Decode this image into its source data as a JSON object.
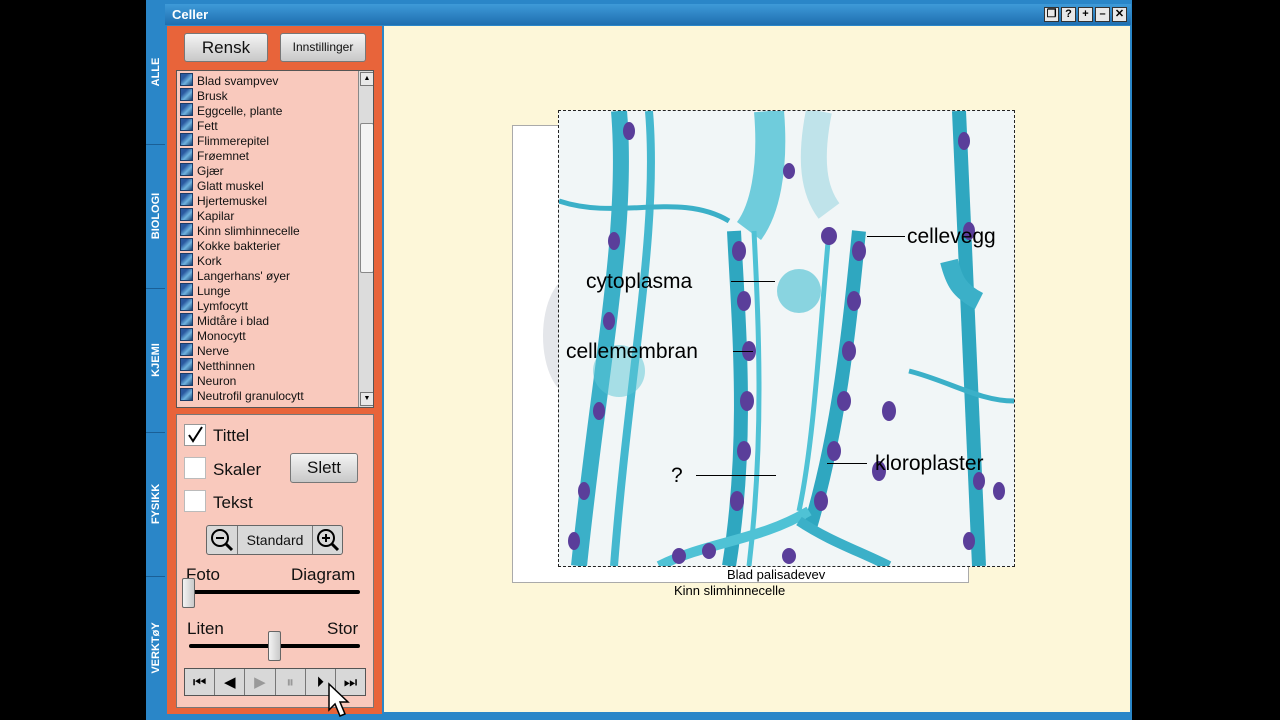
{
  "window": {
    "title": "Celler",
    "buttons": [
      "❐",
      "?",
      "+",
      "–",
      "✕"
    ]
  },
  "side_tabs": [
    "ALLE",
    "BIOLOGI",
    "KJEMI",
    "FYSIKK",
    "VERKTøY"
  ],
  "toolbar": {
    "clear_label": "Rensk",
    "settings_label": "Innstillinger"
  },
  "list": {
    "items": [
      "Blad svampvev",
      "Brusk",
      "Eggcelle, plante",
      "Fett",
      "Flimmerepitel",
      "Frøemnet",
      "Gjær",
      "Glatt muskel",
      "Hjertemuskel",
      "Kapilar",
      "Kinn slimhinnecelle",
      "Kokke bakterier",
      "Kork",
      "Langerhans' øyer",
      "Lunge",
      "Lymfocytt",
      "Midtåre i blad",
      "Monocytt",
      "Nerve",
      "Netthinnen",
      "Neuron",
      "Neutrofil granulocytt"
    ]
  },
  "controls": {
    "title_label": "Tittel",
    "title_checked": true,
    "scale_label": "Skaler",
    "scale_checked": false,
    "text_label": "Tekst",
    "text_checked": false,
    "delete_label": "Slett",
    "zoom_label": "Standard",
    "slider1": {
      "left": "Foto",
      "right": "Diagram",
      "value": 0.0
    },
    "slider2": {
      "left": "Liten",
      "right": "Stor",
      "value": 0.5
    }
  },
  "media": {
    "buttons": [
      "⏮",
      "◀",
      "▶",
      "⏸",
      "⏵",
      "⏭"
    ]
  },
  "image": {
    "labels": {
      "cell_wall": "cellevegg",
      "cytoplasm": "cytoplasma",
      "membrane": "cellemembran",
      "unknown": "?",
      "chloroplasts": "kloroplaster"
    },
    "caption_front": "Blad palisadevev",
    "caption_back": "Kinn slimhinnecelle"
  },
  "colors": {
    "panel": "#e8643a",
    "list_bg": "#f9c9bd",
    "window_blue": "#2a86c8",
    "content_bg": "#fdf7d9"
  }
}
